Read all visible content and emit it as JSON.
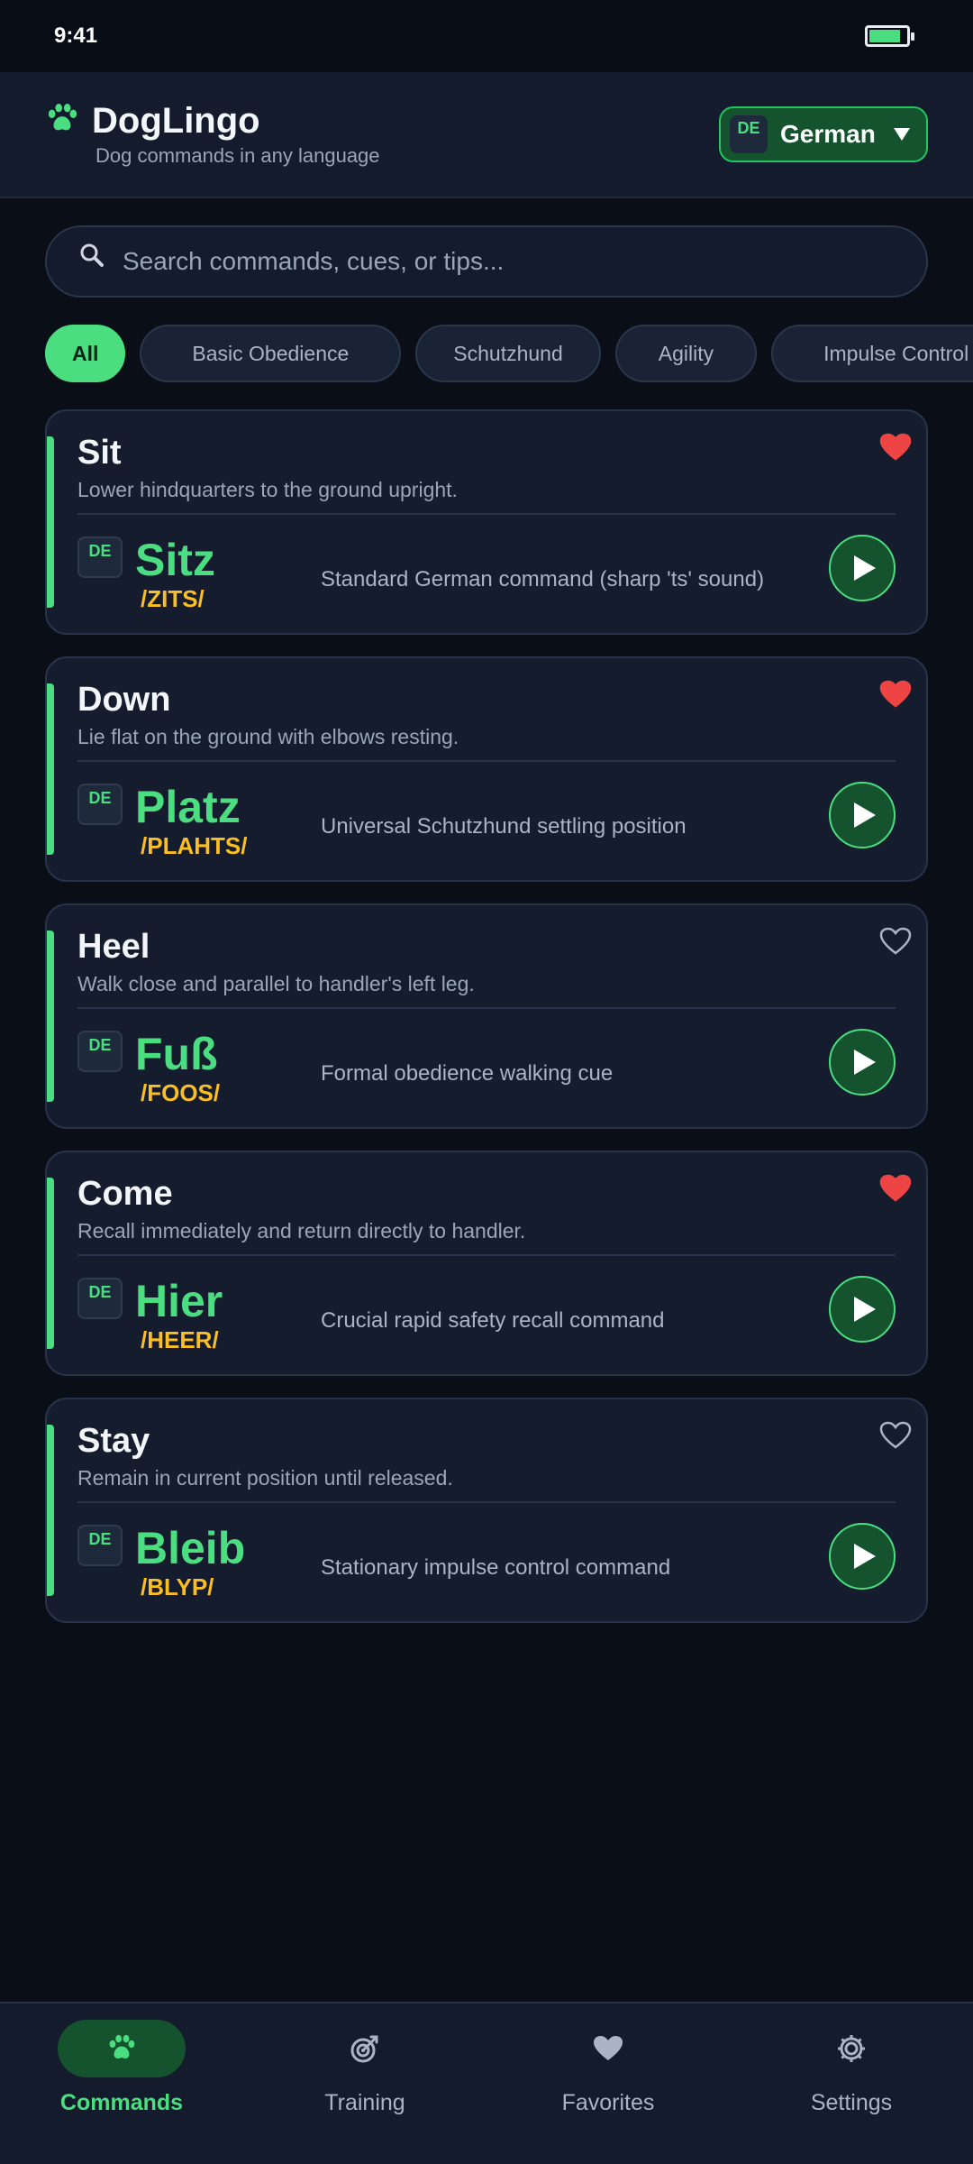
{
  "status": {
    "time": "9:41",
    "battery_level": 0.85
  },
  "header": {
    "title": "DogLingo",
    "subtitle": "Dog commands in any language",
    "language": {
      "code": "DE",
      "label": "German"
    }
  },
  "search": {
    "placeholder": "Search commands, cues, or tips...",
    "value": ""
  },
  "filters": {
    "active": "All",
    "items": [
      "All",
      "Basic Obedience",
      "Schutzhund",
      "Agility",
      "Impulse Control"
    ]
  },
  "commands": [
    {
      "title": "Sit",
      "desc": "Lower hindquarters to the ground upright.",
      "lang": "DE",
      "word": "Sitz",
      "phonetic": "/ZITS/",
      "note": "Standard German command (sharp 'ts' sound)",
      "favorite": true
    },
    {
      "title": "Down",
      "desc": "Lie flat on the ground with elbows resting.",
      "lang": "DE",
      "word": "Platz",
      "phonetic": "/PLAHTS/",
      "note": "Universal Schutzhund settling position",
      "favorite": true
    },
    {
      "title": "Heel",
      "desc": "Walk close and parallel to handler's left leg.",
      "lang": "DE",
      "word": "Fuß",
      "phonetic": "/FOOS/",
      "note": "Formal obedience walking cue",
      "favorite": false
    },
    {
      "title": "Come",
      "desc": "Recall immediately and return directly to handler.",
      "lang": "DE",
      "word": "Hier",
      "phonetic": "/HEER/",
      "note": "Crucial rapid safety recall command",
      "favorite": true
    },
    {
      "title": "Stay",
      "desc": "Remain in current position until released.",
      "lang": "DE",
      "word": "Bleib",
      "phonetic": "/BLYP/",
      "note": "Stationary impulse control command",
      "favorite": false
    }
  ],
  "nav": [
    {
      "label": "Commands",
      "icon": "paw-icon",
      "active": true
    },
    {
      "label": "Training",
      "icon": "target-icon",
      "active": false
    },
    {
      "label": "Favorites",
      "icon": "heart-icon",
      "active": false
    },
    {
      "label": "Settings",
      "icon": "gear-icon",
      "active": false
    }
  ],
  "colors": {
    "accent": "#4ade80",
    "phonetic": "#fbbf24",
    "favorite": "#ef4444",
    "background": "#0a0e17",
    "card": "#141c2d"
  }
}
